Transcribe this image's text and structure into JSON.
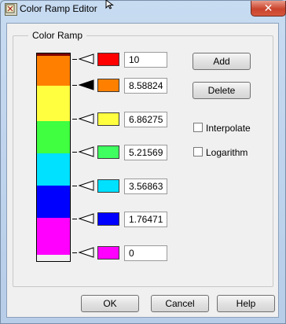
{
  "window": {
    "title": "Color Ramp Editor",
    "close_glyph": "✕"
  },
  "group": {
    "label": "Color Ramp"
  },
  "ramp": {
    "bands": [
      {
        "color": "#800000"
      },
      {
        "color": "#ff8000"
      },
      {
        "color": "#ffff40"
      },
      {
        "color": "#40ff40"
      },
      {
        "color": "#00e0ff"
      },
      {
        "color": "#0000ff"
      },
      {
        "color": "#ff00ff"
      }
    ]
  },
  "markers": [
    {
      "value": "10",
      "color": "#ff0000",
      "selected": false
    },
    {
      "value": "8.58824",
      "color": "#ff8000",
      "selected": true
    },
    {
      "value": "6.86275",
      "color": "#ffff40",
      "selected": false
    },
    {
      "value": "5.21569",
      "color": "#40ff60",
      "selected": false
    },
    {
      "value": "3.56863",
      "color": "#00e0ff",
      "selected": false
    },
    {
      "value": "1.76471",
      "color": "#0000ff",
      "selected": false
    },
    {
      "value": "0",
      "color": "#ff00ff",
      "selected": false
    }
  ],
  "buttons": {
    "add": "Add",
    "delete": "Delete",
    "ok": "OK",
    "cancel": "Cancel",
    "help": "Help"
  },
  "options": {
    "interpolate": {
      "label": "Interpolate",
      "checked": false
    },
    "logarithm": {
      "label": "Logarithm",
      "checked": false
    }
  },
  "icons": {
    "app": "labview-app-icon",
    "cursor": "mouse-cursor-icon",
    "marker": "triangle-pointer-icon"
  }
}
